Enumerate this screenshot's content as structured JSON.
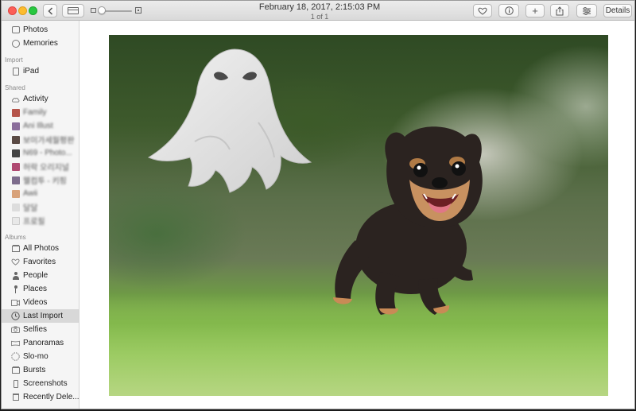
{
  "window": {
    "title": "February 18, 2017, 2:15:03 PM",
    "subtitle": "1 of 1"
  },
  "toolbar": {
    "back_icon": "chevron-left-icon",
    "add_label": "+",
    "details_label": "Details"
  },
  "sidebar": {
    "library": [
      {
        "label": "Photos",
        "icon": "photos-icon"
      },
      {
        "label": "Memories",
        "icon": "memories-icon"
      }
    ],
    "import_header": "Import",
    "import_items": [
      {
        "label": "iPad",
        "icon": "ipad-icon"
      }
    ],
    "shared_header": "Shared",
    "shared_items": [
      {
        "label": "Activity",
        "icon": "cloud-icon"
      },
      {
        "label": "Family",
        "icon": "album-thumb-icon"
      },
      {
        "label": "Ani Illust",
        "icon": "album-thumb-icon"
      },
      {
        "label": "보미가세월평판",
        "icon": "album-thumb-icon"
      },
      {
        "label": "N69 - Photo...",
        "icon": "album-thumb-icon"
      },
      {
        "label": "허락 오리지널",
        "icon": "album-thumb-icon"
      },
      {
        "label": "웰컴투 - 키핑",
        "icon": "album-thumb-icon"
      },
      {
        "label": "Awii",
        "icon": "album-thumb-icon"
      },
      {
        "label": "달달",
        "icon": "album-thumb-icon"
      },
      {
        "label": "프로필",
        "icon": "album-thumb-icon"
      }
    ],
    "albums_header": "Albums",
    "albums": [
      {
        "label": "All Photos",
        "icon": "all-photos-icon"
      },
      {
        "label": "Favorites",
        "icon": "heart-icon"
      },
      {
        "label": "People",
        "icon": "person-icon"
      },
      {
        "label": "Places",
        "icon": "pin-icon"
      },
      {
        "label": "Videos",
        "icon": "video-icon"
      },
      {
        "label": "Last Import",
        "icon": "clock-icon",
        "selected": true
      },
      {
        "label": "Selfies",
        "icon": "camera-icon"
      },
      {
        "label": "Panoramas",
        "icon": "panorama-icon"
      },
      {
        "label": "Slo-mo",
        "icon": "slomo-icon"
      },
      {
        "label": "Bursts",
        "icon": "bursts-icon"
      },
      {
        "label": "Screenshots",
        "icon": "screenshot-icon"
      },
      {
        "label": "Recently Dele...",
        "icon": "trash-icon"
      }
    ]
  },
  "colors": {
    "selection": "#d8d8d8",
    "sidebar_bg": "#f5f5f5",
    "close": "#fc5f57",
    "minimize": "#fdbc2e",
    "maximize": "#28c840"
  }
}
